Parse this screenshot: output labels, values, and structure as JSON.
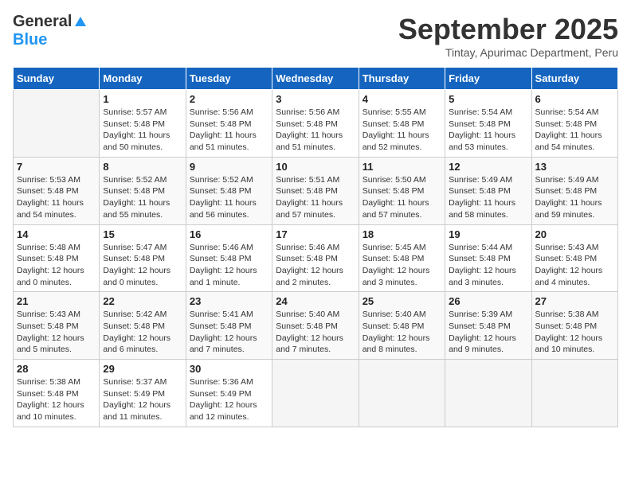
{
  "logo": {
    "general": "General",
    "blue": "Blue"
  },
  "title": {
    "month": "September 2025",
    "location": "Tintay, Apurimac Department, Peru"
  },
  "weekdays": [
    "Sunday",
    "Monday",
    "Tuesday",
    "Wednesday",
    "Thursday",
    "Friday",
    "Saturday"
  ],
  "weeks": [
    [
      {
        "day": "",
        "info": ""
      },
      {
        "day": "1",
        "info": "Sunrise: 5:57 AM\nSunset: 5:48 PM\nDaylight: 11 hours\nand 50 minutes."
      },
      {
        "day": "2",
        "info": "Sunrise: 5:56 AM\nSunset: 5:48 PM\nDaylight: 11 hours\nand 51 minutes."
      },
      {
        "day": "3",
        "info": "Sunrise: 5:56 AM\nSunset: 5:48 PM\nDaylight: 11 hours\nand 51 minutes."
      },
      {
        "day": "4",
        "info": "Sunrise: 5:55 AM\nSunset: 5:48 PM\nDaylight: 11 hours\nand 52 minutes."
      },
      {
        "day": "5",
        "info": "Sunrise: 5:54 AM\nSunset: 5:48 PM\nDaylight: 11 hours\nand 53 minutes."
      },
      {
        "day": "6",
        "info": "Sunrise: 5:54 AM\nSunset: 5:48 PM\nDaylight: 11 hours\nand 54 minutes."
      }
    ],
    [
      {
        "day": "7",
        "info": "Sunrise: 5:53 AM\nSunset: 5:48 PM\nDaylight: 11 hours\nand 54 minutes."
      },
      {
        "day": "8",
        "info": "Sunrise: 5:52 AM\nSunset: 5:48 PM\nDaylight: 11 hours\nand 55 minutes."
      },
      {
        "day": "9",
        "info": "Sunrise: 5:52 AM\nSunset: 5:48 PM\nDaylight: 11 hours\nand 56 minutes."
      },
      {
        "day": "10",
        "info": "Sunrise: 5:51 AM\nSunset: 5:48 PM\nDaylight: 11 hours\nand 57 minutes."
      },
      {
        "day": "11",
        "info": "Sunrise: 5:50 AM\nSunset: 5:48 PM\nDaylight: 11 hours\nand 57 minutes."
      },
      {
        "day": "12",
        "info": "Sunrise: 5:49 AM\nSunset: 5:48 PM\nDaylight: 11 hours\nand 58 minutes."
      },
      {
        "day": "13",
        "info": "Sunrise: 5:49 AM\nSunset: 5:48 PM\nDaylight: 11 hours\nand 59 minutes."
      }
    ],
    [
      {
        "day": "14",
        "info": "Sunrise: 5:48 AM\nSunset: 5:48 PM\nDaylight: 12 hours\nand 0 minutes."
      },
      {
        "day": "15",
        "info": "Sunrise: 5:47 AM\nSunset: 5:48 PM\nDaylight: 12 hours\nand 0 minutes."
      },
      {
        "day": "16",
        "info": "Sunrise: 5:46 AM\nSunset: 5:48 PM\nDaylight: 12 hours\nand 1 minute."
      },
      {
        "day": "17",
        "info": "Sunrise: 5:46 AM\nSunset: 5:48 PM\nDaylight: 12 hours\nand 2 minutes."
      },
      {
        "day": "18",
        "info": "Sunrise: 5:45 AM\nSunset: 5:48 PM\nDaylight: 12 hours\nand 3 minutes."
      },
      {
        "day": "19",
        "info": "Sunrise: 5:44 AM\nSunset: 5:48 PM\nDaylight: 12 hours\nand 3 minutes."
      },
      {
        "day": "20",
        "info": "Sunrise: 5:43 AM\nSunset: 5:48 PM\nDaylight: 12 hours\nand 4 minutes."
      }
    ],
    [
      {
        "day": "21",
        "info": "Sunrise: 5:43 AM\nSunset: 5:48 PM\nDaylight: 12 hours\nand 5 minutes."
      },
      {
        "day": "22",
        "info": "Sunrise: 5:42 AM\nSunset: 5:48 PM\nDaylight: 12 hours\nand 6 minutes."
      },
      {
        "day": "23",
        "info": "Sunrise: 5:41 AM\nSunset: 5:48 PM\nDaylight: 12 hours\nand 7 minutes."
      },
      {
        "day": "24",
        "info": "Sunrise: 5:40 AM\nSunset: 5:48 PM\nDaylight: 12 hours\nand 7 minutes."
      },
      {
        "day": "25",
        "info": "Sunrise: 5:40 AM\nSunset: 5:48 PM\nDaylight: 12 hours\nand 8 minutes."
      },
      {
        "day": "26",
        "info": "Sunrise: 5:39 AM\nSunset: 5:48 PM\nDaylight: 12 hours\nand 9 minutes."
      },
      {
        "day": "27",
        "info": "Sunrise: 5:38 AM\nSunset: 5:48 PM\nDaylight: 12 hours\nand 10 minutes."
      }
    ],
    [
      {
        "day": "28",
        "info": "Sunrise: 5:38 AM\nSunset: 5:48 PM\nDaylight: 12 hours\nand 10 minutes."
      },
      {
        "day": "29",
        "info": "Sunrise: 5:37 AM\nSunset: 5:49 PM\nDaylight: 12 hours\nand 11 minutes."
      },
      {
        "day": "30",
        "info": "Sunrise: 5:36 AM\nSunset: 5:49 PM\nDaylight: 12 hours\nand 12 minutes."
      },
      {
        "day": "",
        "info": ""
      },
      {
        "day": "",
        "info": ""
      },
      {
        "day": "",
        "info": ""
      },
      {
        "day": "",
        "info": ""
      }
    ]
  ]
}
